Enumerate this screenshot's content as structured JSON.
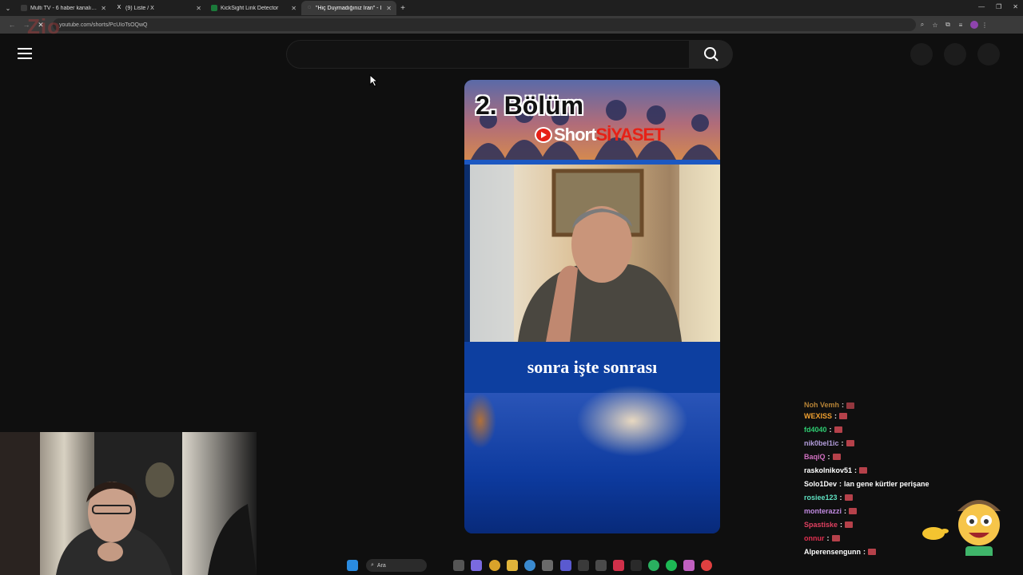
{
  "browser": {
    "tabs": [
      {
        "title": "Multi TV - 6 haber kanalını aynı",
        "active": false,
        "favicon_color": "#3a3a3a"
      },
      {
        "title": "(9) Liste / X",
        "active": false,
        "favicon": "X"
      },
      {
        "title": "KickSight Link Detector",
        "active": false,
        "favicon_color": "#1b7a3a"
      },
      {
        "title": "\"Hiç Duymadığınız İran\" - I",
        "active": true,
        "favicon_color": "#777"
      }
    ],
    "url": "youtube.com/shorts/PcUIoTsOQwQ",
    "watermark": "Zio"
  },
  "youtube": {
    "search_placeholder": ""
  },
  "short": {
    "banner_title": "2. Bölüm",
    "brand_part1": "Short",
    "brand_part2": "SİYASET",
    "caption": "sonra işte sonrası"
  },
  "chat": {
    "messages": [
      {
        "user": "Noh Vemh",
        "color": "#e0a040",
        "message": "",
        "emote": true,
        "cut": true
      },
      {
        "user": "WEXISS",
        "color": "#f0a030",
        "message": "",
        "emote": true
      },
      {
        "user": "fd4040",
        "color": "#2ecc71",
        "message": "",
        "emote": true
      },
      {
        "user": "nik0bel1ic",
        "color": "#b39ddb",
        "message": "",
        "emote": true
      },
      {
        "user": "BaqiQ",
        "color": "#d070c0",
        "message": "",
        "emote": true
      },
      {
        "user": "raskolnikov51",
        "color": "#ffffff",
        "message": "",
        "emote": true
      },
      {
        "user": "Solo1Dev",
        "color": "#ffffff",
        "message": "lan gene kürtler perişane",
        "emote": false
      },
      {
        "user": "rosiee123",
        "color": "#5ee0c0",
        "message": "",
        "emote": true
      },
      {
        "user": "monterazzi",
        "color": "#c08ae0",
        "message": "",
        "emote": true
      },
      {
        "user": "Spastiske",
        "color": "#e04060",
        "message": "",
        "emote": true
      },
      {
        "user": "onnur",
        "color": "#e03050",
        "message": "",
        "emote": true
      },
      {
        "user": "Alperensengunn",
        "color": "#ffffff",
        "message": "",
        "emote": true
      }
    ]
  },
  "taskbar": {
    "search_label": "Ara"
  }
}
